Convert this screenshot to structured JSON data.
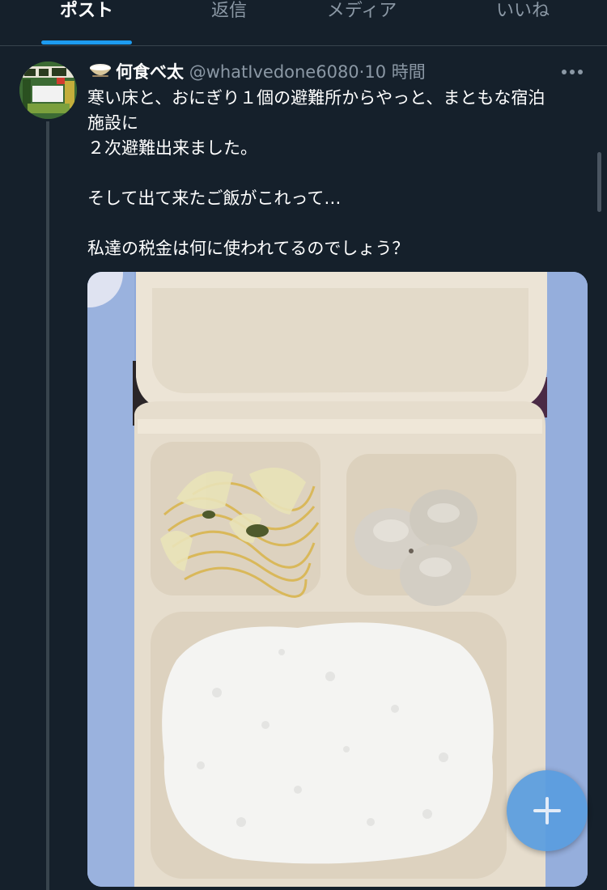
{
  "tabs": [
    {
      "label": "ポスト",
      "active": true
    },
    {
      "label": "返信",
      "active": false
    },
    {
      "label": "メディア",
      "active": false
    },
    {
      "label": "いいね",
      "active": false
    }
  ],
  "tweet": {
    "display_name": "何食べ太",
    "handle": "@whatIvedone6080",
    "separator": "·",
    "time": "10 時間",
    "more_icon": "more-horizontal-icon",
    "name_icon": "rice-bowl-icon",
    "lines": [
      "寒い床と、おにぎり１個の避難所からやっと、まともな宿泊",
      "施設に",
      "２次避難出来ました。",
      "",
      "そして出て来たご飯がこれって…",
      "",
      "私達の税金は何に使われてるのでしょう？"
    ],
    "media_description_icon": "bento-photo"
  },
  "fab": {
    "icon": "plus-icon"
  },
  "colors": {
    "background": "#15202b",
    "accent": "#1d9bf0",
    "muted_text": "#8b98a5",
    "fab": "#5a9de0"
  }
}
